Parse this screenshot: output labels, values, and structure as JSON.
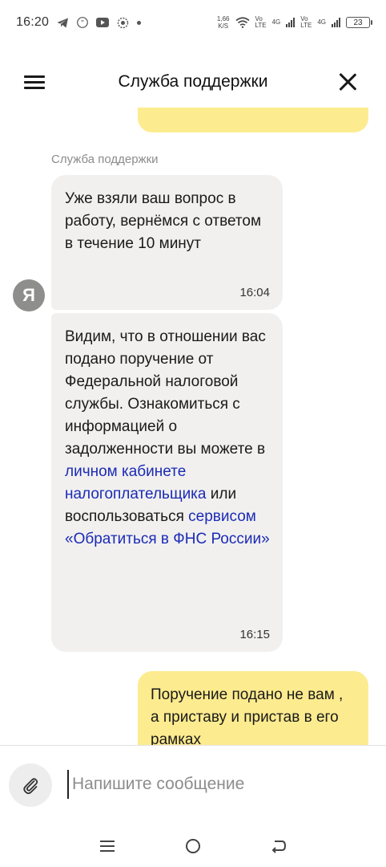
{
  "status_bar": {
    "time": "16:20",
    "speed_value": "1,66",
    "speed_unit": "K/S",
    "sim1_tag_top": "Vo",
    "sim1_tag_bottom": "LTE",
    "sim1_net": "4G",
    "sim2_tag_top": "Vo",
    "sim2_tag_bottom": "LTE",
    "sim2_net": "4G",
    "battery": "23",
    "icons": [
      "telegram-icon",
      "quote-icon",
      "youtube-icon",
      "notification-icon",
      "wifi-icon",
      "signal-icon"
    ]
  },
  "header": {
    "title": "Служба поддержки",
    "menu_icon": "hamburger-icon",
    "close_icon": "close-icon"
  },
  "chat": {
    "sender_name": "Служба поддержки",
    "avatar_letter": "Я",
    "messages": [
      {
        "text": "Уже взяли ваш вопрос в работу, вернёмся с ответом в течение 10 минут",
        "time": "16:04"
      },
      {
        "text_part1": "Видим, что в отношении вас подано поручение от Федеральной налоговой службы. Ознакомиться с информацией о задолженности вы можете в ",
        "link1": "личном кабинете налогоплательщика",
        "text_part2": " или воспользоваться ",
        "link2": "сервисом «Обратиться в ФНС России»",
        "time": "16:15"
      }
    ],
    "user_message": "Поручение подано не вам , а приставу и пристав в его рамках"
  },
  "composer": {
    "placeholder": "Напишите сообщение",
    "attach_icon": "paperclip-icon"
  },
  "navbar": {
    "icons": [
      "menu-nav-icon",
      "home-nav-icon",
      "back-nav-icon"
    ]
  },
  "colors": {
    "user_bubble": "#fdeb8f",
    "support_bubble": "#f1f0ef",
    "link": "#1b2bb5"
  }
}
